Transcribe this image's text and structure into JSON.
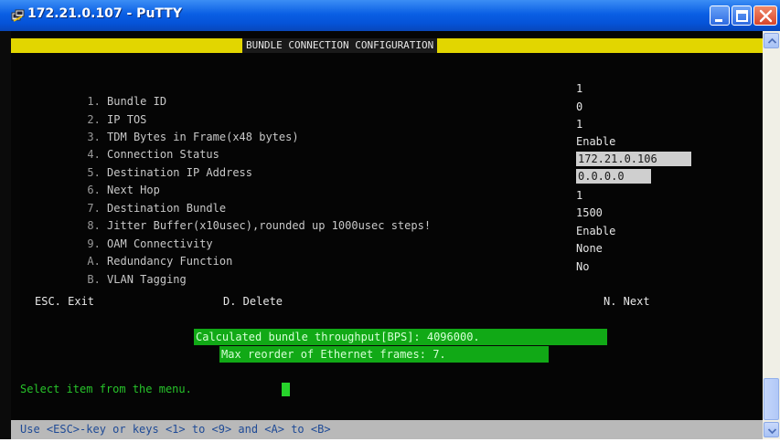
{
  "window": {
    "title": "172.21.0.107 - PuTTY"
  },
  "screen": {
    "header": "BUNDLE CONNECTION CONFIGURATION",
    "items": [
      {
        "key": "1.",
        "label": "Bundle ID",
        "value": "1",
        "highlight": false
      },
      {
        "key": "2.",
        "label": "IP TOS",
        "value": "0",
        "highlight": false
      },
      {
        "key": "3.",
        "label": "TDM Bytes in Frame(x48 bytes)",
        "value": "1",
        "highlight": false
      },
      {
        "key": "4.",
        "label": "Connection Status",
        "value": "Enable",
        "highlight": false
      },
      {
        "key": "5.",
        "label": "Destination IP Address",
        "value": "172.21.0.106",
        "highlight": true
      },
      {
        "key": "6.",
        "label": "Next Hop",
        "value": "0.0.0.0",
        "highlight": true
      },
      {
        "key": "7.",
        "label": "Destination Bundle",
        "value": "1",
        "highlight": false
      },
      {
        "key": "8.",
        "label": "Jitter Buffer(x10usec),rounded up 1000usec steps!",
        "value": "1500",
        "highlight": false
      },
      {
        "key": "9.",
        "label": "OAM Connectivity",
        "value": "Enable",
        "highlight": false
      },
      {
        "key": "A.",
        "label": "Redundancy Function",
        "value": "None",
        "highlight": false
      },
      {
        "key": "B.",
        "label": "VLAN Tagging",
        "value": "No",
        "highlight": false
      }
    ],
    "actions": {
      "exit": "ESC. Exit",
      "delete": "D. Delete",
      "next": "N. Next"
    },
    "info_line1": "Calculated bundle throughput[BPS]: 4096000.",
    "info_line2": "Max reorder of Ethernet frames: 7.",
    "prompt": "Select item from the menu.",
    "status": "Use <ESC>-key or keys <1> to <9> and <A> to <B>"
  },
  "colors": {
    "title_bar": "#0a5fe4",
    "header_band": "#e2d600",
    "info_box": "#11a916",
    "prompt_text": "#27c32a",
    "status_bar": "#b9b9b9"
  },
  "icons": {
    "app": "putty-icon",
    "minimize": "minimize-icon",
    "maximize": "maximize-icon",
    "close": "close-icon"
  }
}
